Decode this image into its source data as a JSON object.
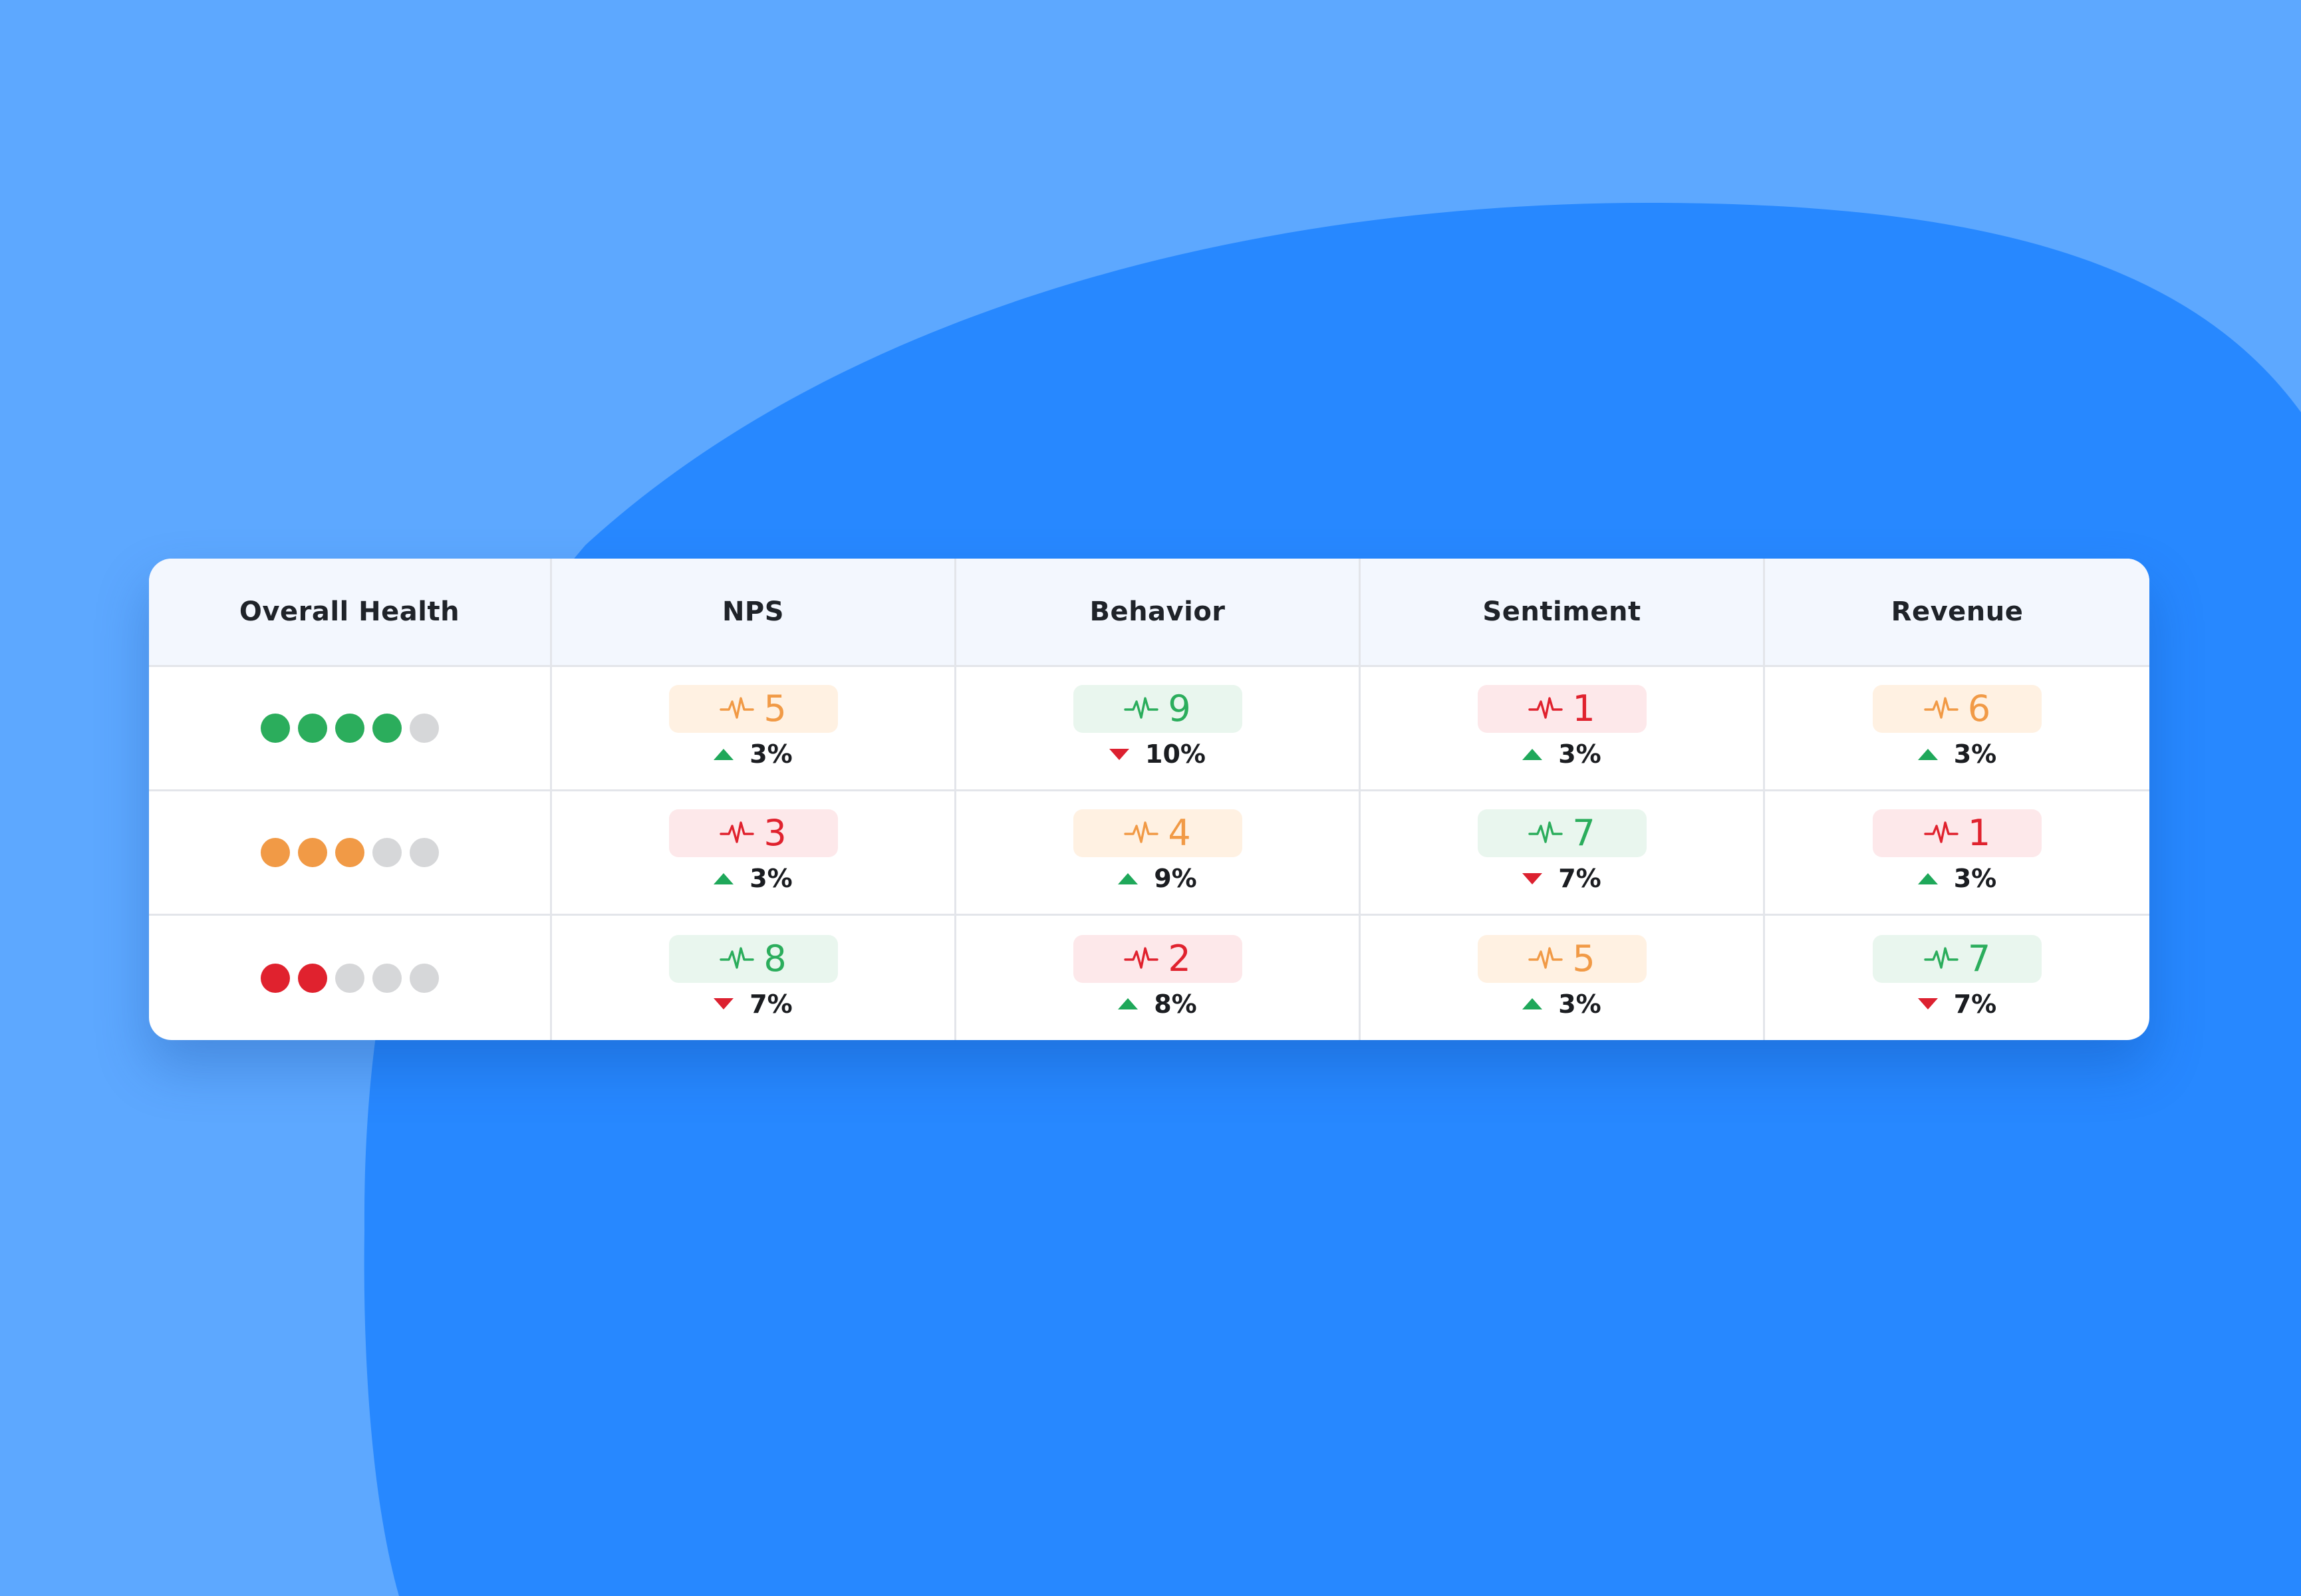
{
  "colors": {
    "background_light": "#5da8ff",
    "background_blob": "#2788ff",
    "green": "#2bad5c",
    "green_bg": "#e9f6ee",
    "orange": "#f19a46",
    "orange_bg": "#fff1e2",
    "red": "#e0222e",
    "red_bg": "#fde8ea",
    "dot_empty": "#d6d7d9"
  },
  "table": {
    "headers": [
      "Overall Health",
      "NPS",
      "Behavior",
      "Sentiment",
      "Revenue"
    ],
    "rows": [
      {
        "health": {
          "filled": 4,
          "total": 5,
          "color": "green"
        },
        "cells": [
          {
            "score": "5",
            "status": "orange",
            "trend": "up",
            "delta": "3%"
          },
          {
            "score": "9",
            "status": "green",
            "trend": "down",
            "delta": "10%"
          },
          {
            "score": "1",
            "status": "red",
            "trend": "up",
            "delta": "3%"
          },
          {
            "score": "6",
            "status": "orange",
            "trend": "up",
            "delta": "3%"
          }
        ]
      },
      {
        "health": {
          "filled": 3,
          "total": 5,
          "color": "orange"
        },
        "cells": [
          {
            "score": "3",
            "status": "red",
            "trend": "up",
            "delta": "3%"
          },
          {
            "score": "4",
            "status": "orange",
            "trend": "up",
            "delta": "9%"
          },
          {
            "score": "7",
            "status": "green",
            "trend": "down",
            "delta": "7%"
          },
          {
            "score": "1",
            "status": "red",
            "trend": "up",
            "delta": "3%"
          }
        ]
      },
      {
        "health": {
          "filled": 2,
          "total": 5,
          "color": "red"
        },
        "cells": [
          {
            "score": "8",
            "status": "green",
            "trend": "down",
            "delta": "7%"
          },
          {
            "score": "2",
            "status": "red",
            "trend": "up",
            "delta": "8%"
          },
          {
            "score": "5",
            "status": "orange",
            "trend": "up",
            "delta": "3%"
          },
          {
            "score": "7",
            "status": "green",
            "trend": "down",
            "delta": "7%"
          }
        ]
      }
    ],
    "score_icon": "pulse-icon",
    "trend_icons": {
      "up": "arrow-up-icon",
      "down": "arrow-down-icon"
    }
  }
}
